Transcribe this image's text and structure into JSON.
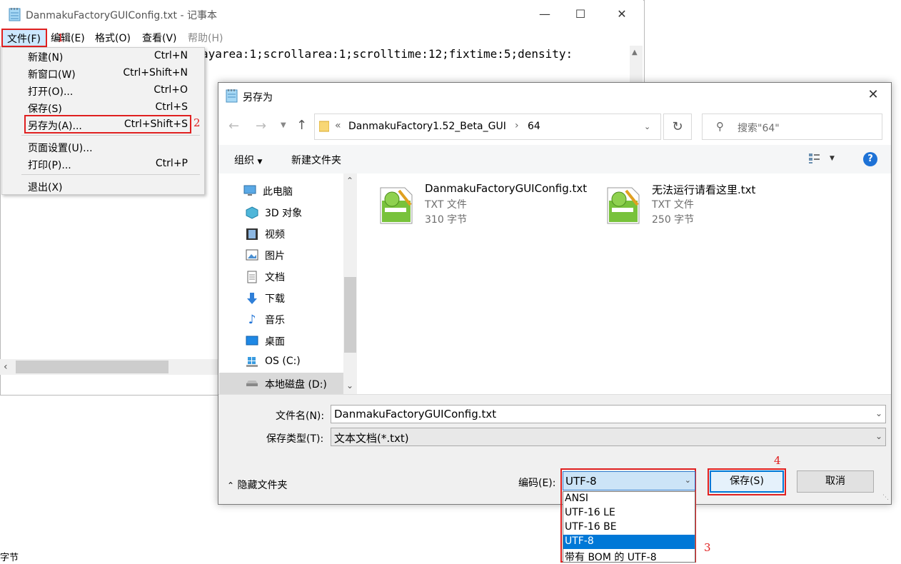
{
  "notepad": {
    "title": "DanmakuFactoryGUIConfig.txt - 记事本",
    "menus": [
      "文件(F)",
      "编辑(E)",
      "格式(O)",
      "查看(V)",
      "帮助(H)"
    ],
    "text_visible": "ayarea:1;scrollarea:1;scrolltime:12;fixtime:5;density:",
    "status_fragment": "字节"
  },
  "file_menu": {
    "items": [
      {
        "label": "新建(N)",
        "shortcut": "Ctrl+N"
      },
      {
        "label": "新窗口(W)",
        "shortcut": "Ctrl+Shift+N"
      },
      {
        "label": "打开(O)...",
        "shortcut": "Ctrl+O"
      },
      {
        "label": "保存(S)",
        "shortcut": "Ctrl+S"
      },
      {
        "label": "另存为(A)...",
        "shortcut": "Ctrl+Shift+S"
      },
      {
        "label": "页面设置(U)...",
        "shortcut": ""
      },
      {
        "label": "打印(P)...",
        "shortcut": "Ctrl+P"
      },
      {
        "label": "退出(X)",
        "shortcut": ""
      }
    ]
  },
  "steps": {
    "s1": "1",
    "s2": "2",
    "s3": "3",
    "s4": "4"
  },
  "dialog": {
    "title": "另存为",
    "address": {
      "prefix": "«",
      "crumbs": [
        "DanmakuFactory1.52_Beta_GUI",
        "64"
      ]
    },
    "search_placeholder": "搜索\"64\"",
    "toolbar": {
      "organize": "组织",
      "new_folder": "新建文件夹"
    },
    "nav_items": [
      "此电脑",
      "3D 对象",
      "视频",
      "图片",
      "文档",
      "下载",
      "音乐",
      "桌面",
      "OS (C:)",
      "本地磁盘 (D:)"
    ],
    "files": [
      {
        "name": "DanmakuFactoryGUIConfig.txt",
        "type": "TXT 文件",
        "size": "310 字节"
      },
      {
        "name": "无法运行请看这里.txt",
        "type": "TXT 文件",
        "size": "250 字节"
      }
    ],
    "filename_label": "文件名(N):",
    "filename_value": "DanmakuFactoryGUIConfig.txt",
    "filetype_label": "保存类型(T):",
    "filetype_value": "文本文档(*.txt)",
    "hide_folders": "隐藏文件夹",
    "encoding_label": "编码(E):",
    "encoding_value": "UTF-8",
    "encoding_options": [
      "ANSI",
      "UTF-16 LE",
      "UTF-16 BE",
      "UTF-8",
      "带有 BOM 的 UTF-8"
    ],
    "save_label": "保存(S)",
    "cancel_label": "取消"
  },
  "colors": {
    "highlight_red": "#e02020",
    "selection_blue": "#0078d7",
    "accent_blue": "#cce8ff"
  }
}
